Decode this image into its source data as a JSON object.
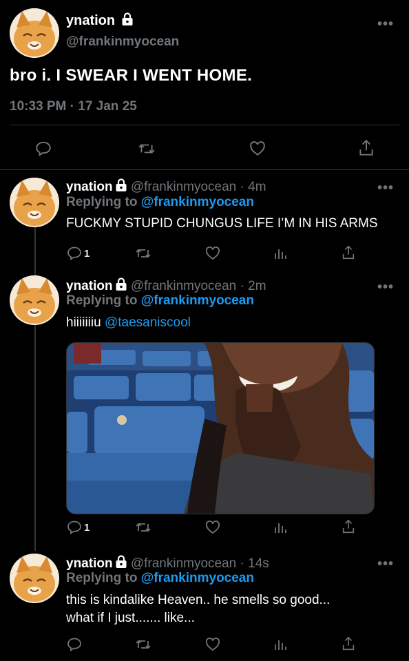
{
  "main_tweet": {
    "name": "ynation",
    "handle": "@frankinmyocean",
    "text": "bro i. I SWEAR I WENT HOME.",
    "timestamp": "10:33 PM · 17 Jan 25"
  },
  "replies": [
    {
      "name": "ynation",
      "handle": "@frankinmyocean",
      "age": "· 4m",
      "replying_label": "Replying to",
      "replying_handle": "@frankinmyocean",
      "text": "FUCKMY STUPID CHUNGUS LIFE I’M IN HIS ARMS",
      "reply_count": "1"
    },
    {
      "name": "ynation",
      "handle": "@frankinmyocean",
      "age": "· 2m",
      "replying_label": "Replying to",
      "replying_handle": "@frankinmyocean",
      "text": "hiiiiiiiu ",
      "mention": "@taesaniscool",
      "reply_count": "1"
    },
    {
      "name": "ynation",
      "handle": "@frankinmyocean",
      "age": "· 14s",
      "replying_label": "Replying to",
      "replying_handle": "@frankinmyocean",
      "text_line1": "this is kindalike Heaven.. he smells so good...",
      "text_line2": "what if I just....... like...",
      "reply_count": ""
    }
  ],
  "icons": [
    "more-icon",
    "lock-icon",
    "reply-icon",
    "retweet-icon",
    "like-icon",
    "share-icon",
    "analytics-icon"
  ],
  "colors": {
    "background": "#000000",
    "text": "#e7e9ea",
    "muted": "#71767b",
    "link": "#1d9bf0",
    "divider": "#2f3336"
  }
}
